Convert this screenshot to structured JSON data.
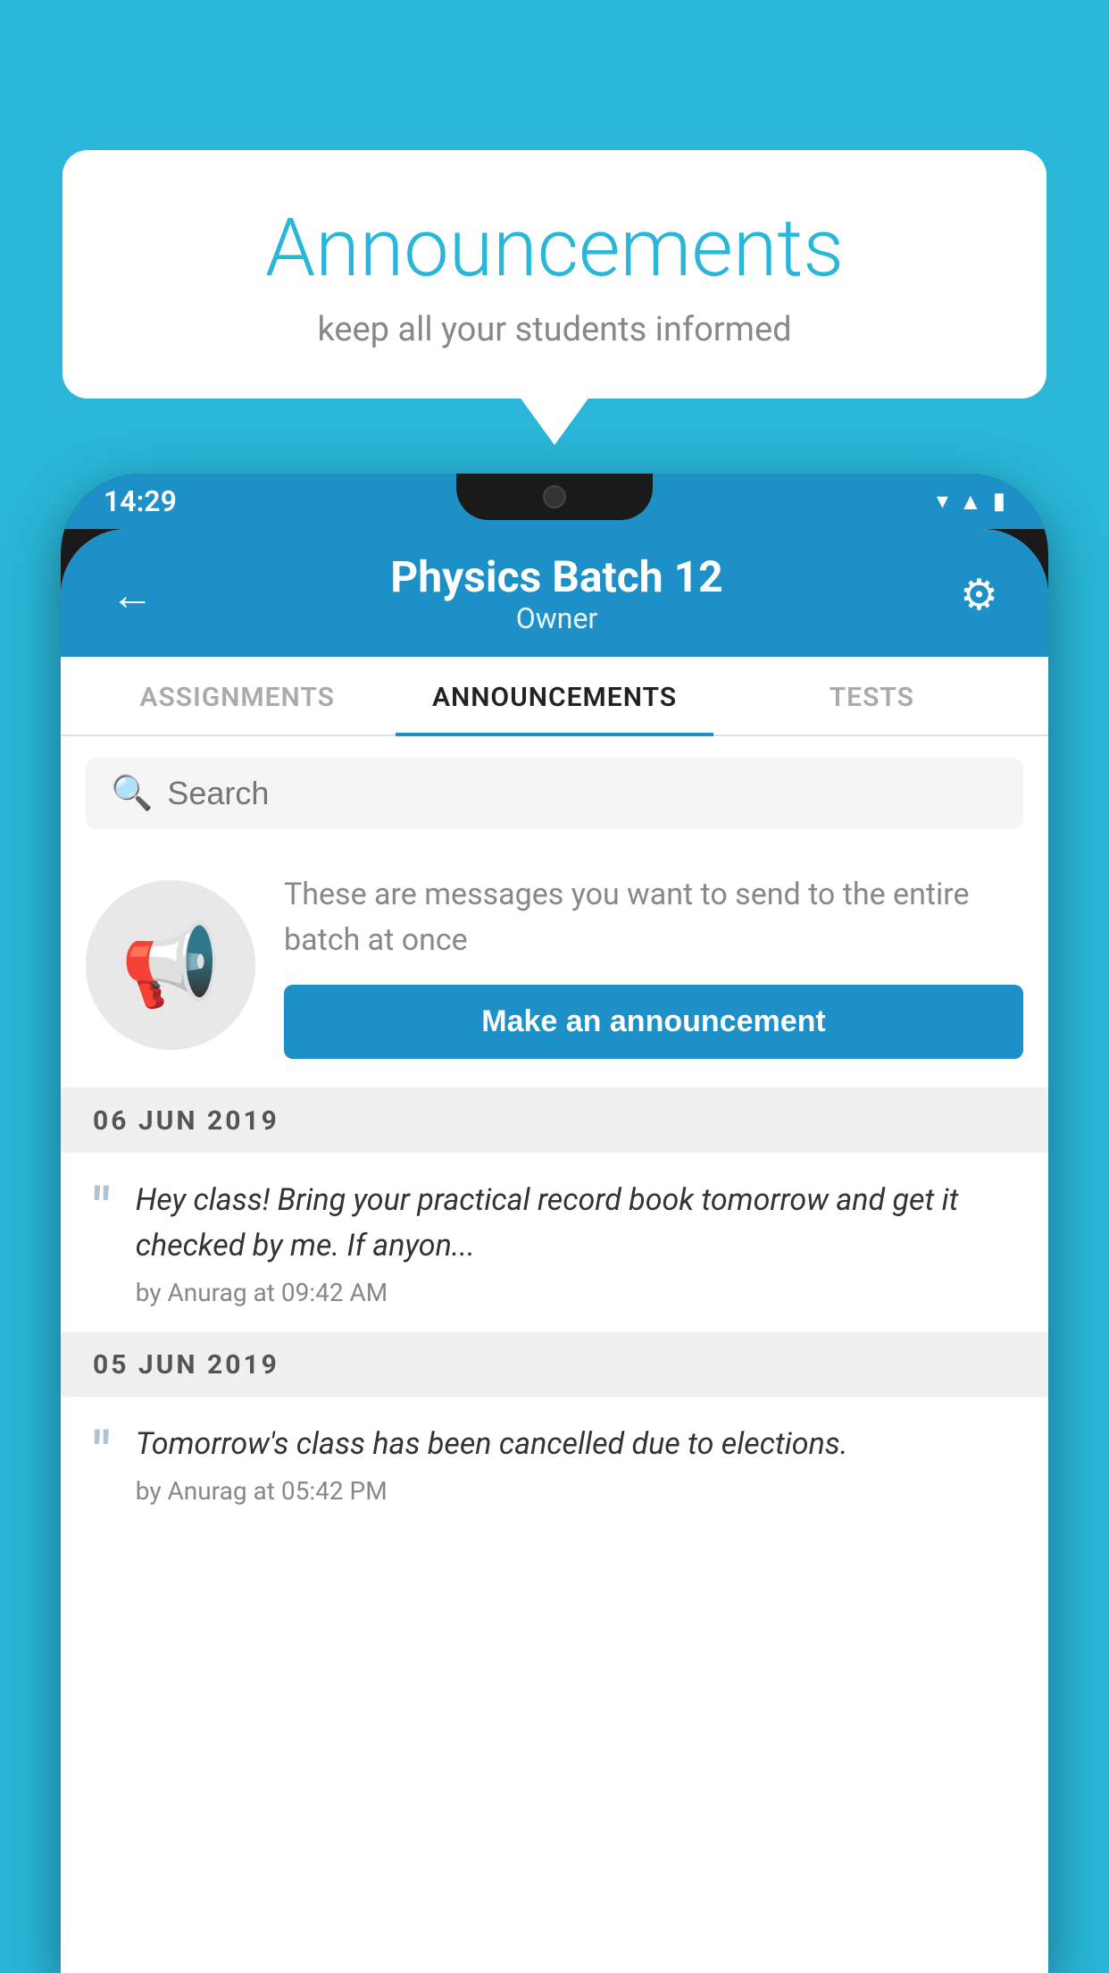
{
  "background_color": "#29b6d8",
  "speech_bubble": {
    "title": "Announcements",
    "subtitle": "keep all your students informed"
  },
  "status_bar": {
    "time": "14:29",
    "icons": [
      "wifi",
      "signal",
      "battery"
    ]
  },
  "app_header": {
    "title": "Physics Batch 12",
    "subtitle": "Owner",
    "back_label": "←",
    "gear_label": "⚙"
  },
  "tabs": [
    {
      "label": "ASSIGNMENTS",
      "active": false
    },
    {
      "label": "ANNOUNCEMENTS",
      "active": true
    },
    {
      "label": "TESTS",
      "active": false
    },
    {
      "label": "...",
      "active": false
    }
  ],
  "search": {
    "placeholder": "Search"
  },
  "promo": {
    "text": "These are messages you want to send to the entire batch at once",
    "button_label": "Make an announcement"
  },
  "announcements": [
    {
      "date": "06  JUN  2019",
      "text": "Hey class! Bring your practical record book tomorrow and get it checked by me. If anyon...",
      "meta": "by Anurag at 09:42 AM"
    },
    {
      "date": "05  JUN  2019",
      "text": "Tomorrow's class has been cancelled due to elections.",
      "meta": "by Anurag at 05:42 PM"
    }
  ]
}
